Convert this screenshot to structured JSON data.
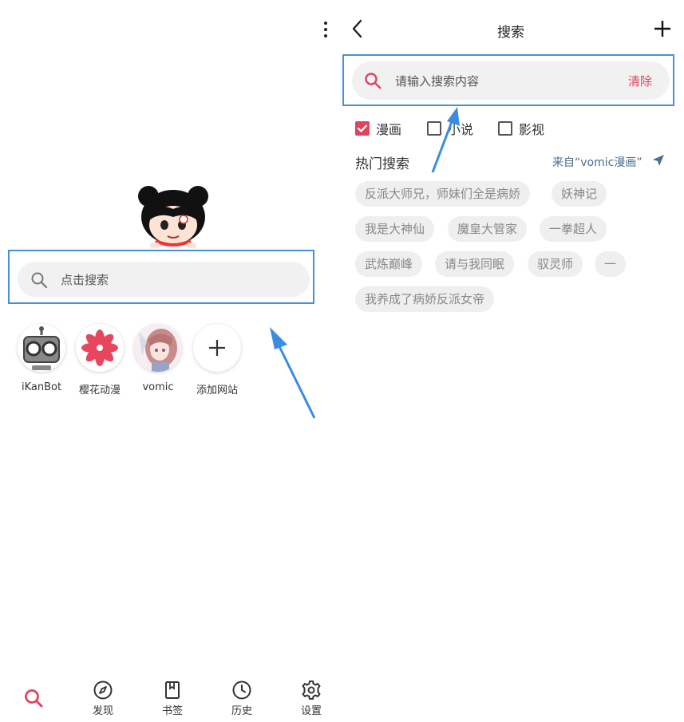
{
  "home": {
    "search_placeholder": "点击搜索",
    "sites": [
      {
        "label": "iKanBot"
      },
      {
        "label": "樱花动漫"
      },
      {
        "label": "vomic"
      },
      {
        "label": "添加网站"
      }
    ],
    "nav": [
      {
        "label": ""
      },
      {
        "label": "发现"
      },
      {
        "label": "书签"
      },
      {
        "label": "历史"
      },
      {
        "label": "设置"
      }
    ]
  },
  "search_page": {
    "title": "搜索",
    "input_placeholder": "请输入搜索内容",
    "clear_label": "清除",
    "filters": [
      {
        "label": "漫画",
        "checked": true
      },
      {
        "label": "小说",
        "checked": false
      },
      {
        "label": "影视",
        "checked": false
      }
    ],
    "hot_title": "热门搜索",
    "hot_source": "来自“vomic漫画”",
    "hot_tags": [
      "反派大师兄，师妹们全是病娇",
      "妖神记",
      "我是大神仙",
      "魔皇大管家",
      "一拳超人",
      "武炼巅峰",
      "请与我同眠",
      "驭灵师",
      "一",
      "我养成了病娇反派女帝"
    ]
  },
  "colors": {
    "accent": "#e0445e",
    "highlight_frame": "#4a90d9",
    "link": "#4a6f8f"
  }
}
